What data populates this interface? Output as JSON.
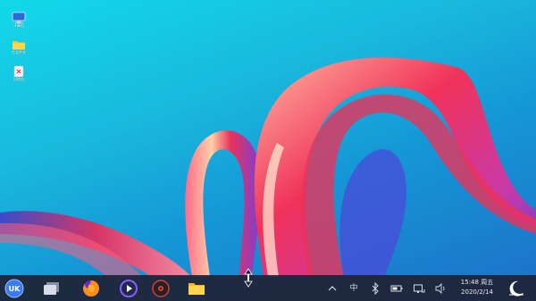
{
  "desktop": {
    "icons": [
      {
        "name": "computer",
        "label": "计算机"
      },
      {
        "name": "home-folder",
        "label": "主文件夹"
      },
      {
        "name": "trash",
        "label": "回收站"
      }
    ]
  },
  "taskbar": {
    "start_label": "UK",
    "ime_label": "中",
    "clock": {
      "time": "15:48",
      "weekday": "周五",
      "date": "2020/2/14"
    }
  },
  "colors": {
    "taskbar_bg": "#1e2234",
    "desktop_top": "#12d9ea",
    "desktop_bottom": "#1e6fc8",
    "accent": "#e8335a"
  }
}
